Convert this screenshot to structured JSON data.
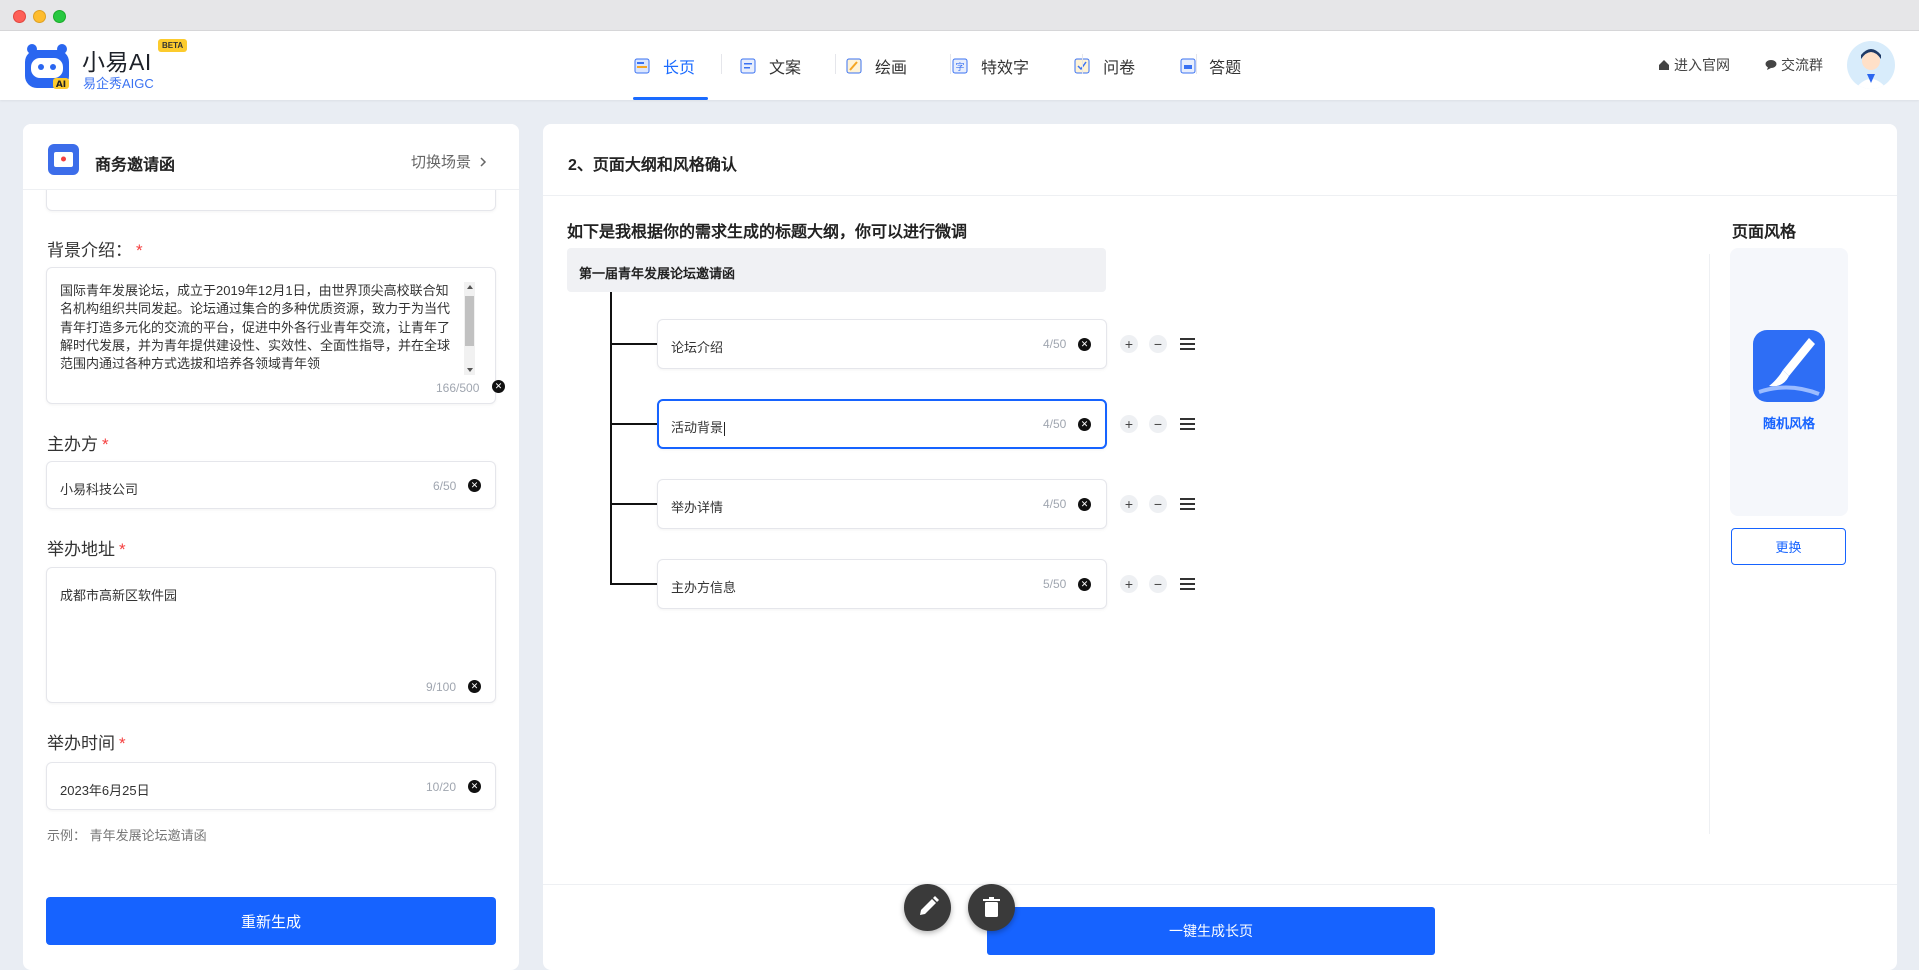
{
  "brand": {
    "name": "小易AI",
    "beta": "BETA",
    "subtitle": "易企秀AIGC"
  },
  "nav": [
    {
      "label": "长页",
      "icon": "long-page-icon",
      "active": true
    },
    {
      "label": "文案",
      "icon": "copywriting-icon",
      "active": false
    },
    {
      "label": "绘画",
      "icon": "painting-icon",
      "active": false
    },
    {
      "label": "特效字",
      "icon": "effect-text-icon",
      "active": false
    },
    {
      "label": "问卷",
      "icon": "survey-icon",
      "active": false
    },
    {
      "label": "答题",
      "icon": "quiz-icon",
      "active": false
    }
  ],
  "header_links": {
    "site": "进入官网",
    "group": "交流群"
  },
  "scene": {
    "title": "商务邀请函",
    "switch_label": "切换场景"
  },
  "form": {
    "background": {
      "label": "背景介绍：",
      "required": "*",
      "value": "国际青年发展论坛，成立于2019年12月1日，由世界顶尖高校联合知名机构组织共同发起。论坛通过集合的多种优质资源，致力于为当代青年打造多元化的交流的平台，促进中外各行业青年交流，让青年了解时代发展，并为青年提供建设性、实效性、全面性指导，并在全球范围内通过各种方式选拔和培养各领域青年领",
      "count": "166/500"
    },
    "organizer": {
      "label": "主办方",
      "required": "*",
      "value": "小易科技公司",
      "count": "6/50"
    },
    "address": {
      "label": "举办地址",
      "required": "*",
      "value": "成都市高新区软件园",
      "count": "9/100"
    },
    "time": {
      "label": "举办时间",
      "required": "*",
      "value": "2023年6月25日",
      "count": "10/20"
    },
    "example": "示例：  青年发展论坛邀请函",
    "regenerate": "重新生成"
  },
  "outline": {
    "step_title": "2、页面大纲和风格确认",
    "hint": "如下是我根据你的需求生成的标题大纲，你可以进行微调",
    "root": "第一届青年发展论坛邀请函",
    "items": [
      {
        "value": "论坛介绍",
        "count": "4/50"
      },
      {
        "value": "活动背景",
        "count": "4/50"
      },
      {
        "value": "举办详情",
        "count": "4/50"
      },
      {
        "value": "主办方信息",
        "count": "5/50"
      }
    ]
  },
  "style": {
    "title": "页面风格",
    "card_label": "随机风格",
    "replace": "更换"
  },
  "generate": "一键生成长页",
  "icons": {
    "add": "+",
    "remove": "−",
    "clear": "✕"
  },
  "colors": {
    "primary": "#1663ff",
    "required": "#f53f3f"
  }
}
